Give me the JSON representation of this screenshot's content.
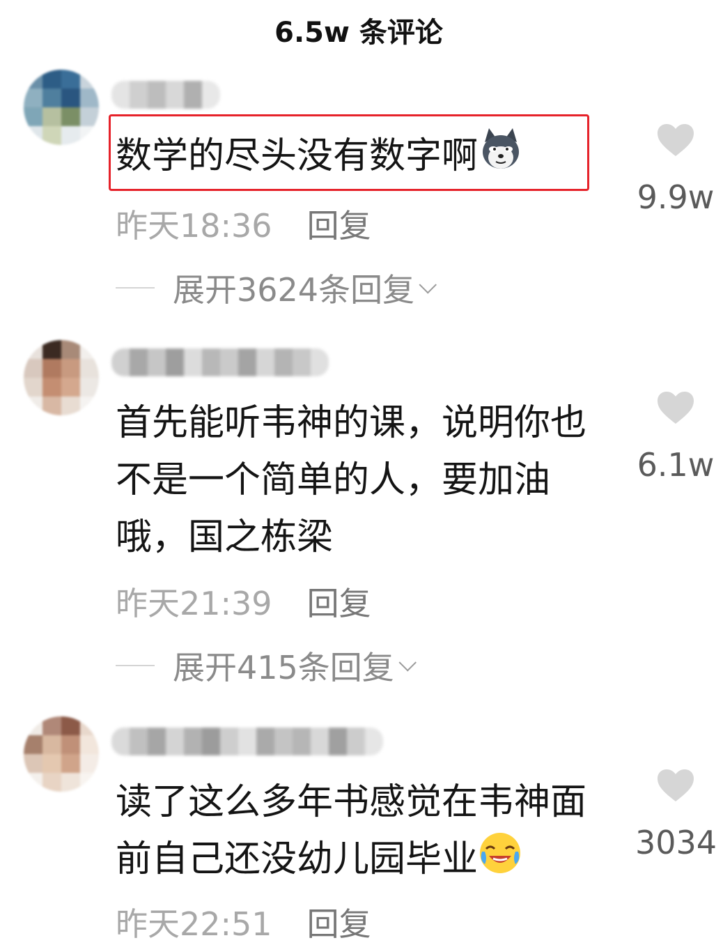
{
  "header": {
    "title": "6.5w 条评论"
  },
  "comments": [
    {
      "text": "数学的尽头没有数字啊",
      "emoji": "husky-dog-emoji",
      "time": "昨天18:36",
      "reply_label": "回复",
      "expand_label": "展开3624条回复",
      "likes": "9.9w",
      "highlighted": true
    },
    {
      "text_lines": [
        "首先能听韦神的课，说明你也",
        "不是一个简单的人，要加油",
        "哦，国之栋梁"
      ],
      "time": "昨天21:39",
      "reply_label": "回复",
      "expand_label": "展开415条回复",
      "likes": "6.1w"
    },
    {
      "text_lines": [
        "读了这么多年书感觉在韦神面",
        "前自己还没幼儿园毕业"
      ],
      "emoji": "laugh-cry-emoji",
      "time": "昨天22:51",
      "reply_label": "回复",
      "likes": "3034"
    }
  ],
  "colors": {
    "highlight_border": "#e6222a",
    "like_icon": "#d6d6d6",
    "meta_text": "#a8a8a8"
  }
}
